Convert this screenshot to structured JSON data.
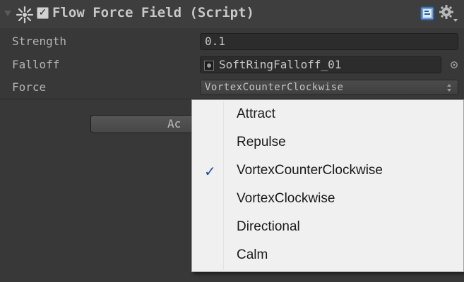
{
  "component": {
    "title": "Flow Force Field (Script)",
    "enabled": true,
    "enabled_glyph": "✓",
    "icons": {
      "foldout": "foldout-arrow-icon",
      "component": "force-field-icon",
      "help": "help-book-icon",
      "settings": "gear-icon"
    }
  },
  "properties": {
    "strength": {
      "label": "Strength",
      "value": "0.1"
    },
    "falloff": {
      "label": "Falloff",
      "value": "SoftRingFalloff_01"
    },
    "force": {
      "label": "Force",
      "value": "VortexCounterClockwise"
    }
  },
  "add_component": {
    "label": "Ac"
  },
  "force_menu": {
    "check_glyph": "✓",
    "selected_index": 2,
    "options": [
      {
        "label": "Attract"
      },
      {
        "label": "Repulse"
      },
      {
        "label": "VortexCounterClockwise"
      },
      {
        "label": "VortexClockwise"
      },
      {
        "label": "Directional"
      },
      {
        "label": "Calm"
      }
    ]
  },
  "colors": {
    "inspector_bg": "#383838",
    "menu_bg": "#f0f0f0",
    "check_accent": "#1d4fa8"
  }
}
